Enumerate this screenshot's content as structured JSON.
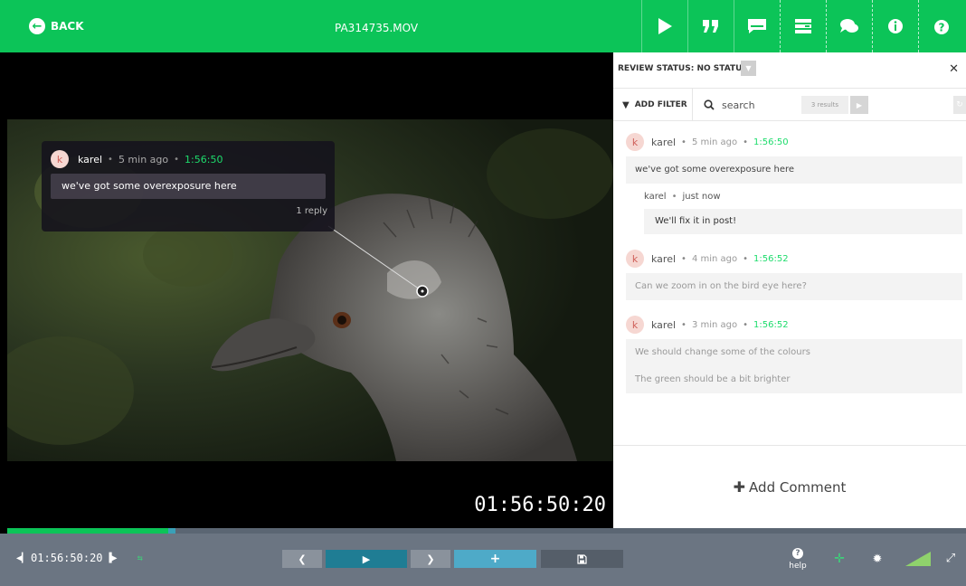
{
  "topbar": {
    "back_label": "BACK",
    "file_title": "PA314735.MOV",
    "tools": [
      "play-icon",
      "quote-icon",
      "comment-icon",
      "list-icon",
      "chat-icon",
      "info-icon",
      "help-icon"
    ]
  },
  "video": {
    "timecode": "01:56:50:20",
    "popup": {
      "avatar": "k",
      "user": "karel",
      "time": "5 min ago",
      "timecode": "1:56:50",
      "message": "we've got some overexposure here",
      "reply_count": "1 reply"
    }
  },
  "panel": {
    "review_status": "REVIEW STATUS: NO STATUS",
    "add_filter": "ADD FILTER",
    "search_placeholder": "search",
    "results": "3 results",
    "comments": [
      {
        "avatar": "k",
        "user": "karel",
        "time": "5 min ago",
        "timecode": "1:56:50",
        "lines": [
          "we've got some overexposure here"
        ],
        "reply": {
          "user": "karel",
          "time": "just now",
          "text": "We'll fix it in post!"
        }
      },
      {
        "avatar": "k",
        "user": "karel",
        "time": "4 min ago",
        "timecode": "1:56:52",
        "lines": [
          "Can we zoom in on the bird eye here?"
        ]
      },
      {
        "avatar": "k",
        "user": "karel",
        "time": "3 min ago",
        "timecode": "1:56:52",
        "lines": [
          "We should change some of the colours",
          "The green should be a bit brighter"
        ]
      }
    ],
    "add_comment": "Add Comment"
  },
  "playback": {
    "timecode": "01:56:50:20",
    "progress": 0.168,
    "help_label": "help"
  },
  "colors": {
    "accent": "#0cc458",
    "timecode_green": "#1ddc6c",
    "control_bar": "#6b7582",
    "play_button": "#1f7d94",
    "add_button": "#4eaac8"
  }
}
